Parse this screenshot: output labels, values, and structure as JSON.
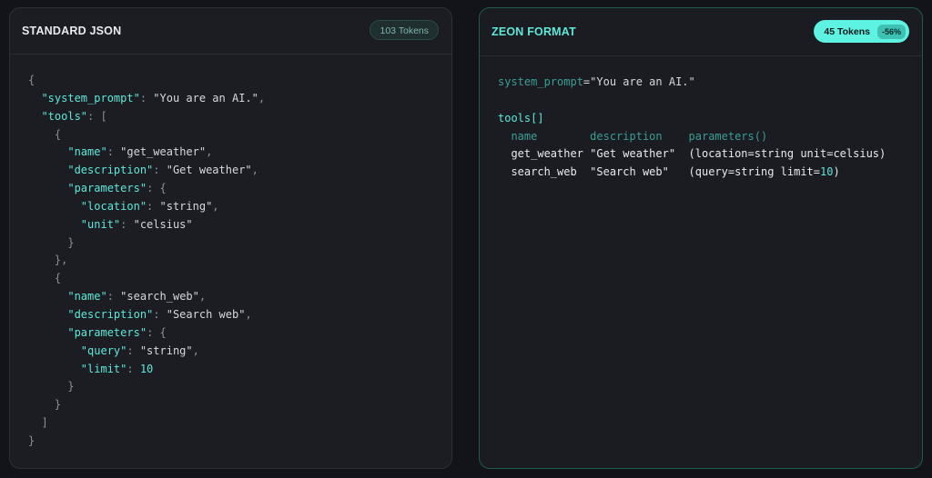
{
  "left_panel": {
    "title": "STANDARD JSON",
    "token_badge": "103 Tokens",
    "code_lines": [
      [
        {
          "t": "{",
          "c": "p"
        }
      ],
      [
        {
          "t": "  ",
          "c": "p"
        },
        {
          "t": "\"system_prompt\"",
          "c": "k"
        },
        {
          "t": ": ",
          "c": "p"
        },
        {
          "t": "\"You are an AI.\"",
          "c": "s"
        },
        {
          "t": ",",
          "c": "p"
        }
      ],
      [
        {
          "t": "  ",
          "c": "p"
        },
        {
          "t": "\"tools\"",
          "c": "k"
        },
        {
          "t": ": [",
          "c": "p"
        }
      ],
      [
        {
          "t": "    {",
          "c": "p"
        }
      ],
      [
        {
          "t": "      ",
          "c": "p"
        },
        {
          "t": "\"name\"",
          "c": "k"
        },
        {
          "t": ": ",
          "c": "p"
        },
        {
          "t": "\"get_weather\"",
          "c": "s"
        },
        {
          "t": ",",
          "c": "p"
        }
      ],
      [
        {
          "t": "      ",
          "c": "p"
        },
        {
          "t": "\"description\"",
          "c": "k"
        },
        {
          "t": ": ",
          "c": "p"
        },
        {
          "t": "\"Get weather\"",
          "c": "s"
        },
        {
          "t": ",",
          "c": "p"
        }
      ],
      [
        {
          "t": "      ",
          "c": "p"
        },
        {
          "t": "\"parameters\"",
          "c": "k"
        },
        {
          "t": ": {",
          "c": "p"
        }
      ],
      [
        {
          "t": "        ",
          "c": "p"
        },
        {
          "t": "\"location\"",
          "c": "k"
        },
        {
          "t": ": ",
          "c": "p"
        },
        {
          "t": "\"string\"",
          "c": "s"
        },
        {
          "t": ",",
          "c": "p"
        }
      ],
      [
        {
          "t": "        ",
          "c": "p"
        },
        {
          "t": "\"unit\"",
          "c": "k"
        },
        {
          "t": ": ",
          "c": "p"
        },
        {
          "t": "\"celsius\"",
          "c": "s"
        }
      ],
      [
        {
          "t": "      }",
          "c": "p"
        }
      ],
      [
        {
          "t": "    },",
          "c": "p"
        }
      ],
      [
        {
          "t": "    {",
          "c": "p"
        }
      ],
      [
        {
          "t": "      ",
          "c": "p"
        },
        {
          "t": "\"name\"",
          "c": "k"
        },
        {
          "t": ": ",
          "c": "p"
        },
        {
          "t": "\"search_web\"",
          "c": "s"
        },
        {
          "t": ",",
          "c": "p"
        }
      ],
      [
        {
          "t": "      ",
          "c": "p"
        },
        {
          "t": "\"description\"",
          "c": "k"
        },
        {
          "t": ": ",
          "c": "p"
        },
        {
          "t": "\"Search web\"",
          "c": "s"
        },
        {
          "t": ",",
          "c": "p"
        }
      ],
      [
        {
          "t": "      ",
          "c": "p"
        },
        {
          "t": "\"parameters\"",
          "c": "k"
        },
        {
          "t": ": {",
          "c": "p"
        }
      ],
      [
        {
          "t": "        ",
          "c": "p"
        },
        {
          "t": "\"query\"",
          "c": "k"
        },
        {
          "t": ": ",
          "c": "p"
        },
        {
          "t": "\"string\"",
          "c": "s"
        },
        {
          "t": ",",
          "c": "p"
        }
      ],
      [
        {
          "t": "        ",
          "c": "p"
        },
        {
          "t": "\"limit\"",
          "c": "k"
        },
        {
          "t": ": ",
          "c": "p"
        },
        {
          "t": "10",
          "c": "n"
        }
      ],
      [
        {
          "t": "      }",
          "c": "p"
        }
      ],
      [
        {
          "t": "    }",
          "c": "p"
        }
      ],
      [
        {
          "t": "  ]",
          "c": "p"
        }
      ],
      [
        {
          "t": "}",
          "c": "p"
        }
      ]
    ]
  },
  "right_panel": {
    "title": "ZEON FORMAT",
    "token_badge": "45 Tokens",
    "savings_badge": "-56%",
    "code_lines": [
      [
        {
          "t": "system_prompt",
          "c": "h"
        },
        {
          "t": "=\"You are an AI.\"",
          "c": "s"
        }
      ],
      [
        {
          "t": "",
          "c": "s"
        }
      ],
      [
        {
          "t": "tools[]",
          "c": "k"
        }
      ],
      [
        {
          "t": "  name        description    parameters()",
          "c": "h"
        }
      ],
      [
        {
          "t": "  get_weather \"Get weather\"  (location=string unit=celsius)",
          "c": "w"
        }
      ],
      [
        {
          "t": "  search_web  \"Search web\"   (query=string limit=",
          "c": "w"
        },
        {
          "t": "10",
          "c": "n"
        },
        {
          "t": ")",
          "c": "w"
        }
      ]
    ]
  },
  "colors": {
    "accent": "#5de8d9",
    "background": "#121419",
    "panel": "#1b1d23"
  }
}
